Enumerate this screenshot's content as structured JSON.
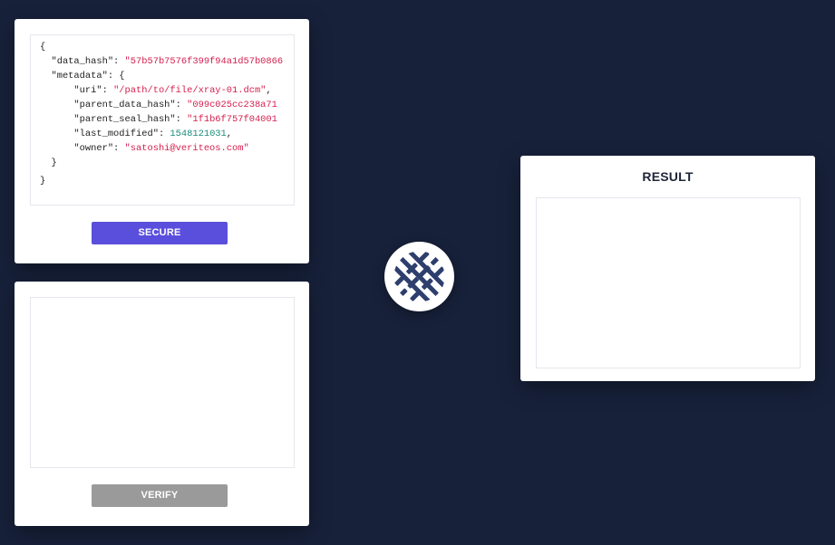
{
  "secure_panel": {
    "code_lines": [
      "{",
      "  \"data_hash\": ",
      "\"57b57b7576f399f94a1d57b0866",
      "  \"metadata\": {",
      "      \"uri\": ",
      "\"/path/to/file/xray-01.dcm\"",
      ",",
      "      \"parent_data_hash\": ",
      "\"099c025cc238a71",
      "      \"parent_seal_hash\": ",
      "\"1f1b6f757f04001",
      "      \"last_modified\": ",
      "1548121031",
      ",",
      "      \"owner\": ",
      "\"satoshi@veriteos.com\"",
      "  }",
      "}"
    ],
    "button_label": "SECURE"
  },
  "verify_panel": {
    "button_label": "VERIFY"
  },
  "result_panel": {
    "title": "RESULT"
  },
  "logo": {
    "icon": "woven-lattice-logo-icon"
  },
  "colors": {
    "background": "#17213a",
    "secure_button": "#5a4fdc",
    "verify_button": "#9a9a9a",
    "string_value": "#d6204f",
    "number_value": "#1a8c7a",
    "logo": "#2e3f6e"
  }
}
